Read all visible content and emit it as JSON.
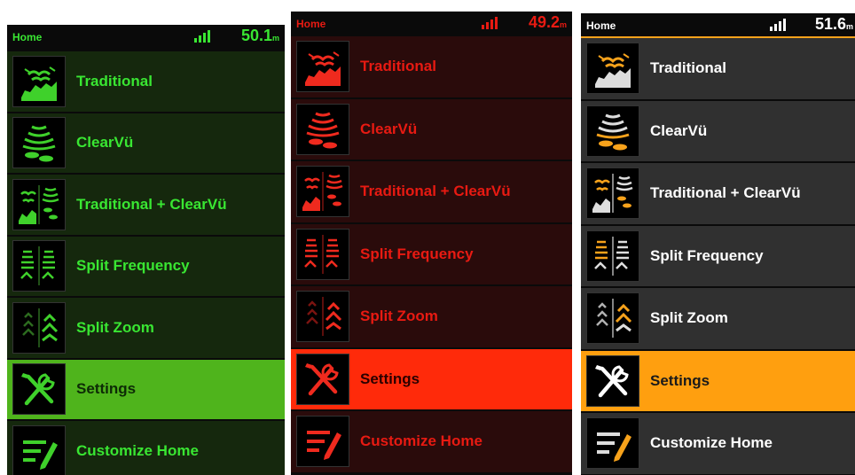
{
  "panels": [
    {
      "theme": "green",
      "home": "Home",
      "depth": "50.1",
      "unit": "m",
      "colors": {
        "text": "#39e632",
        "bg": "#15280d",
        "sel": "#4fb41c",
        "selText": "#0d2b06",
        "accent": "#3fd12b",
        "dim": "#2c6b1f",
        "sep": "#040a02"
      },
      "items": [
        {
          "label": "Traditional",
          "icon": "traditional-sonar-icon"
        },
        {
          "label": "ClearVü",
          "icon": "clearvu-sonar-icon"
        },
        {
          "label": "Traditional + ClearVü",
          "icon": "traditional-clearvu-icon"
        },
        {
          "label": "Split Frequency",
          "icon": "split-frequency-icon"
        },
        {
          "label": "Split Zoom",
          "icon": "split-zoom-icon"
        },
        {
          "label": "Settings",
          "icon": "settings-tools-icon",
          "selected": true
        },
        {
          "label": "Customize Home",
          "icon": "customize-home-icon"
        }
      ]
    },
    {
      "theme": "red",
      "home": "Home",
      "depth": "49.2",
      "unit": "m",
      "colors": {
        "text": "#e81a12",
        "bg": "#2a0b0b",
        "sel": "#ff2a0a",
        "selText": "#2a0000",
        "accent": "#ef2a1e",
        "dim": "#7a1410",
        "sep": "#0a0202"
      },
      "items": [
        {
          "label": "Traditional",
          "icon": "traditional-sonar-icon"
        },
        {
          "label": "ClearVü",
          "icon": "clearvu-sonar-icon"
        },
        {
          "label": "Traditional + ClearVü",
          "icon": "traditional-clearvu-icon"
        },
        {
          "label": "Split Frequency",
          "icon": "split-frequency-icon"
        },
        {
          "label": "Split Zoom",
          "icon": "split-zoom-icon"
        },
        {
          "label": "Settings",
          "icon": "settings-tools-icon",
          "selected": true
        },
        {
          "label": "Customize Home",
          "icon": "customize-home-icon"
        }
      ]
    },
    {
      "theme": "orange",
      "home": "Home",
      "depth": "51.6",
      "unit": "m",
      "colors": {
        "text": "#ffffff",
        "bg": "#303030",
        "sel": "#ff9f0f",
        "selText": "#1a1a1a",
        "accent": "#f7a21b",
        "dim": "#b0b0b0",
        "sep": "#0c0c0c"
      },
      "items": [
        {
          "label": "Traditional",
          "icon": "traditional-sonar-icon"
        },
        {
          "label": "ClearVü",
          "icon": "clearvu-sonar-icon"
        },
        {
          "label": "Traditional + ClearVü",
          "icon": "traditional-clearvu-icon"
        },
        {
          "label": "Split Frequency",
          "icon": "split-frequency-icon"
        },
        {
          "label": "Split Zoom",
          "icon": "split-zoom-icon"
        },
        {
          "label": "Settings",
          "icon": "settings-tools-icon",
          "selected": true
        },
        {
          "label": "Customize Home",
          "icon": "customize-home-icon"
        }
      ]
    }
  ]
}
